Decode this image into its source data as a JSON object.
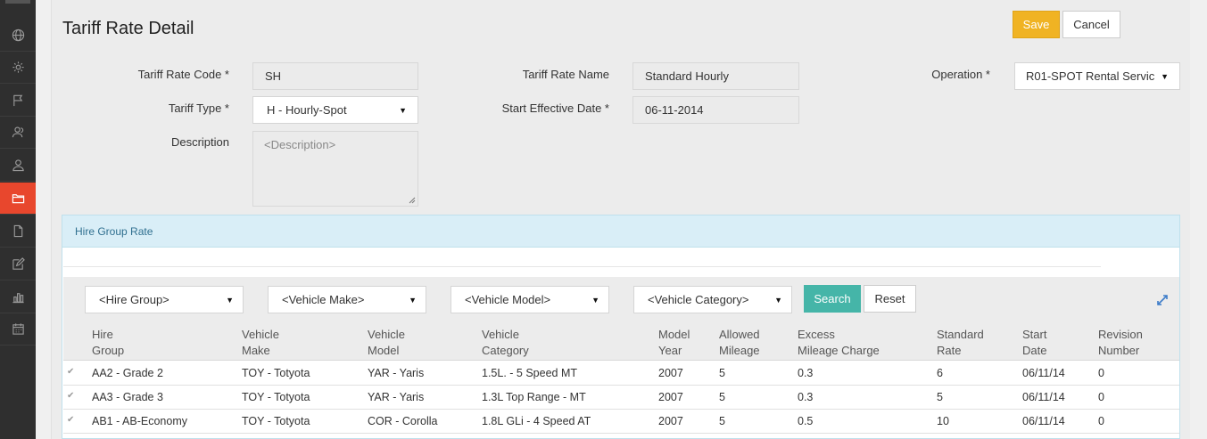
{
  "sidebar": {
    "items": [
      {
        "icon": "globe-icon"
      },
      {
        "icon": "gear-icon"
      },
      {
        "icon": "flag-icon"
      },
      {
        "icon": "users-icon"
      },
      {
        "icon": "user-icon"
      },
      {
        "icon": "folder-icon",
        "active": true
      },
      {
        "icon": "document-icon"
      },
      {
        "icon": "edit-icon"
      },
      {
        "icon": "bar-chart-icon"
      },
      {
        "icon": "calendar-icon"
      }
    ]
  },
  "header": {
    "title": "Tariff Rate Detail",
    "save_label": "Save",
    "cancel_label": "Cancel"
  },
  "form": {
    "tariff_rate_code_label": "Tariff Rate Code *",
    "tariff_rate_code_value": "SH",
    "tariff_rate_name_label": "Tariff Rate Name",
    "tariff_rate_name_value": "Standard Hourly",
    "operation_label": "Operation *",
    "operation_value": "R01-SPOT Rental Servic",
    "tariff_type_label": "Tariff Type *",
    "tariff_type_value": "H - Hourly-Spot",
    "start_effective_date_label": "Start Effective Date *",
    "start_effective_date_value": "06-11-2014",
    "description_label": "Description",
    "description_placeholder": "<Description>"
  },
  "hire_group_rate": {
    "title": "Hire Group Rate",
    "filters": {
      "hire_group": "<Hire Group>",
      "vehicle_make": "<Vehicle Make>",
      "vehicle_model": "<Vehicle Model>",
      "vehicle_category": "<Vehicle Category>"
    },
    "search_label": "Search",
    "reset_label": "Reset",
    "columns": [
      [
        "Hire",
        "Group"
      ],
      [
        "Vehicle",
        "Make"
      ],
      [
        "Vehicle",
        "Model"
      ],
      [
        "Vehicle",
        "Category"
      ],
      [
        "Model",
        "Year"
      ],
      [
        "Allowed",
        "Mileage"
      ],
      [
        "Excess",
        "Mileage Charge"
      ],
      [
        "Standard",
        "Rate"
      ],
      [
        "Start",
        "Date"
      ],
      [
        "Revision",
        "Number"
      ]
    ],
    "rows": [
      [
        "AA2 - Grade 2",
        "TOY - Totyota",
        "YAR - Yaris",
        "1.5L. - 5 Speed MT",
        "2007",
        "5",
        "0.3",
        "6",
        "06/11/14",
        "0"
      ],
      [
        "AA3 - Grade 3",
        "TOY - Totyota",
        "YAR - Yaris",
        "1.3L Top Range - MT",
        "2007",
        "5",
        "0.3",
        "5",
        "06/11/14",
        "0"
      ],
      [
        "AB1 - AB-Economy",
        "TOY - Totyota",
        "COR - Corolla",
        "1.8L GLi - 4 Speed AT",
        "2007",
        "5",
        "0.5",
        "10",
        "06/11/14",
        "0"
      ]
    ]
  }
}
